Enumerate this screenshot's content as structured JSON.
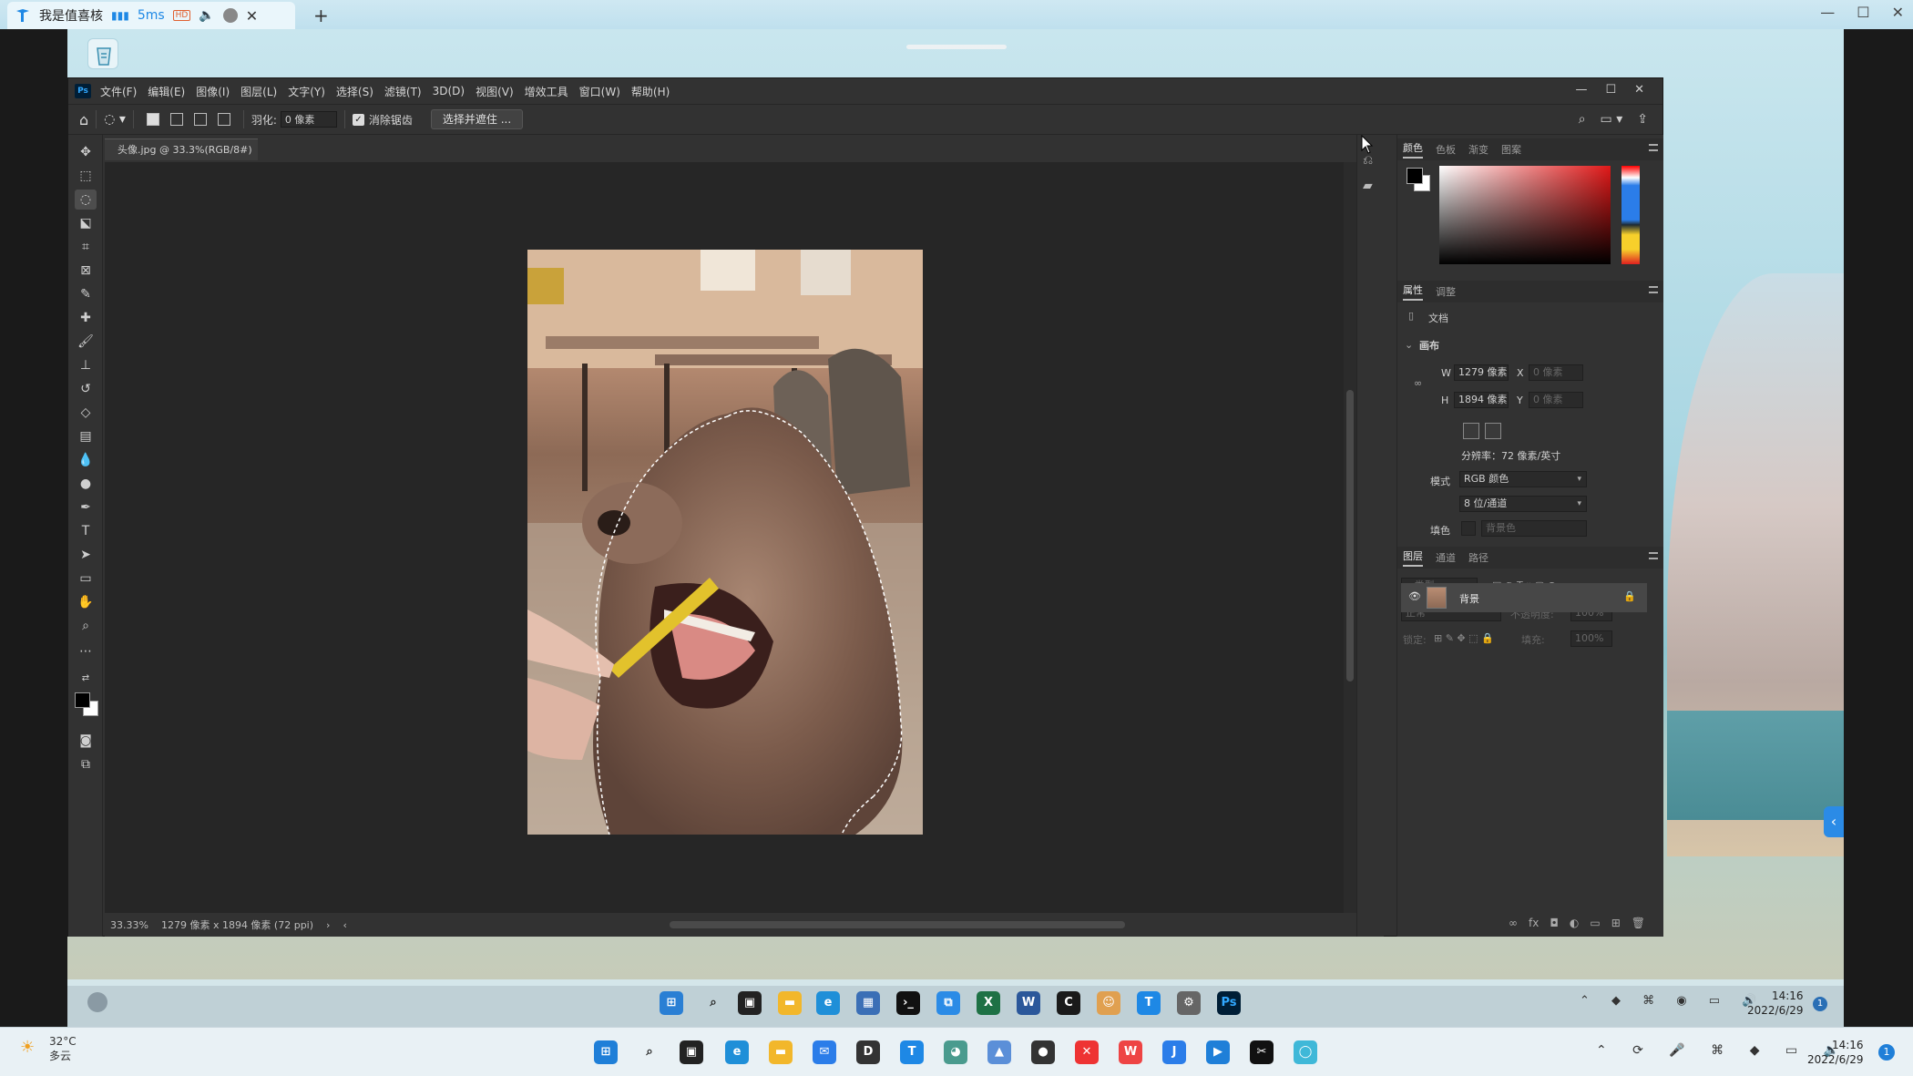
{
  "remote_tab": {
    "title": "我是值喜核",
    "latency": "5ms"
  },
  "menubar": {
    "items": [
      "文件(F)",
      "编辑(E)",
      "图像(I)",
      "图层(L)",
      "文字(Y)",
      "选择(S)",
      "滤镜(T)",
      "3D(D)",
      "视图(V)",
      "增效工具",
      "窗口(W)",
      "帮助(H)"
    ]
  },
  "options": {
    "feather_label": "羽化:",
    "feather_value": "0 像素",
    "antialias_label": "消除锯齿",
    "select_mask_label": "选择并遮住 ..."
  },
  "document": {
    "tab_title": "头像.jpg @ 33.3%(RGB/8#)",
    "zoom": "33.33%",
    "doc_info": "1279 像素 x 1894 像素 (72 ppi)"
  },
  "color_panel": {
    "tabs": [
      "颜色",
      "色板",
      "渐变",
      "图案"
    ]
  },
  "properties_panel": {
    "tabs": [
      "属性",
      "调整"
    ],
    "doc_label": "文档",
    "section": "画布",
    "w_label": "W",
    "w_value": "1279 像素",
    "h_label": "H",
    "h_value": "1894 像素",
    "x_label": "X",
    "x_value": "0 像素",
    "y_label": "Y",
    "y_value": "0 像素",
    "resolution": "分辨率：72 像素/英寸",
    "mode_label": "模式",
    "mode_value": "RGB 颜色",
    "depth_value": "8 位/通道",
    "fill_label": "填色",
    "fill_value": "背景色"
  },
  "layers_panel": {
    "tabs": [
      "图层",
      "通道",
      "路径"
    ],
    "filter_placeholder": "类型",
    "blend_mode": "正常",
    "opacity_label": "不透明度:",
    "opacity_value": "100%",
    "lock_label": "锁定:",
    "fill_label": "填充:",
    "fill_value": "100%",
    "layer_name": "背景"
  },
  "inner_tray": {
    "time": "14:16",
    "date": "2022/6/29"
  },
  "host_tray": {
    "temp": "32°C",
    "condition": "多云",
    "time": "14:16",
    "date": "2022/6/29"
  },
  "colors": {
    "ps_bg": "#323232",
    "canvas_bg": "#262626",
    "accent": "#31a8ff"
  }
}
